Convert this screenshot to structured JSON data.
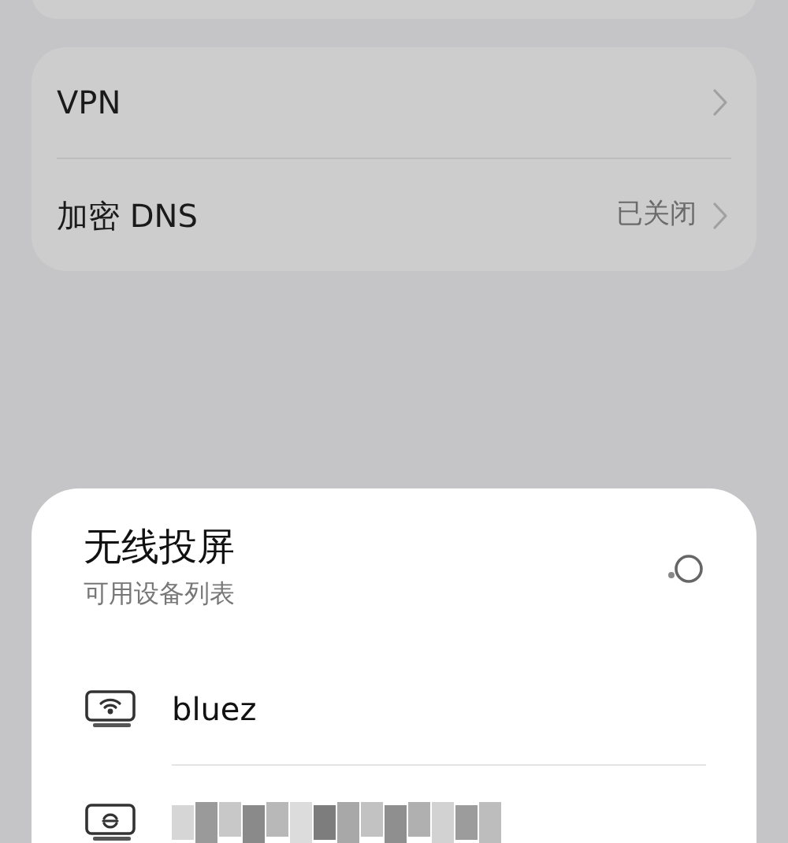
{
  "settings_rows": [
    {
      "label": "VPN"
    },
    {
      "label": "加密 DNS",
      "value": "已关闭"
    }
  ],
  "sheet": {
    "title": "无线投屏",
    "subtitle": "可用设备列表",
    "searching": true,
    "devices": [
      {
        "kind": "wifi",
        "name": "bluez",
        "redacted": false
      },
      {
        "kind": "sync",
        "redacted": true
      }
    ]
  }
}
